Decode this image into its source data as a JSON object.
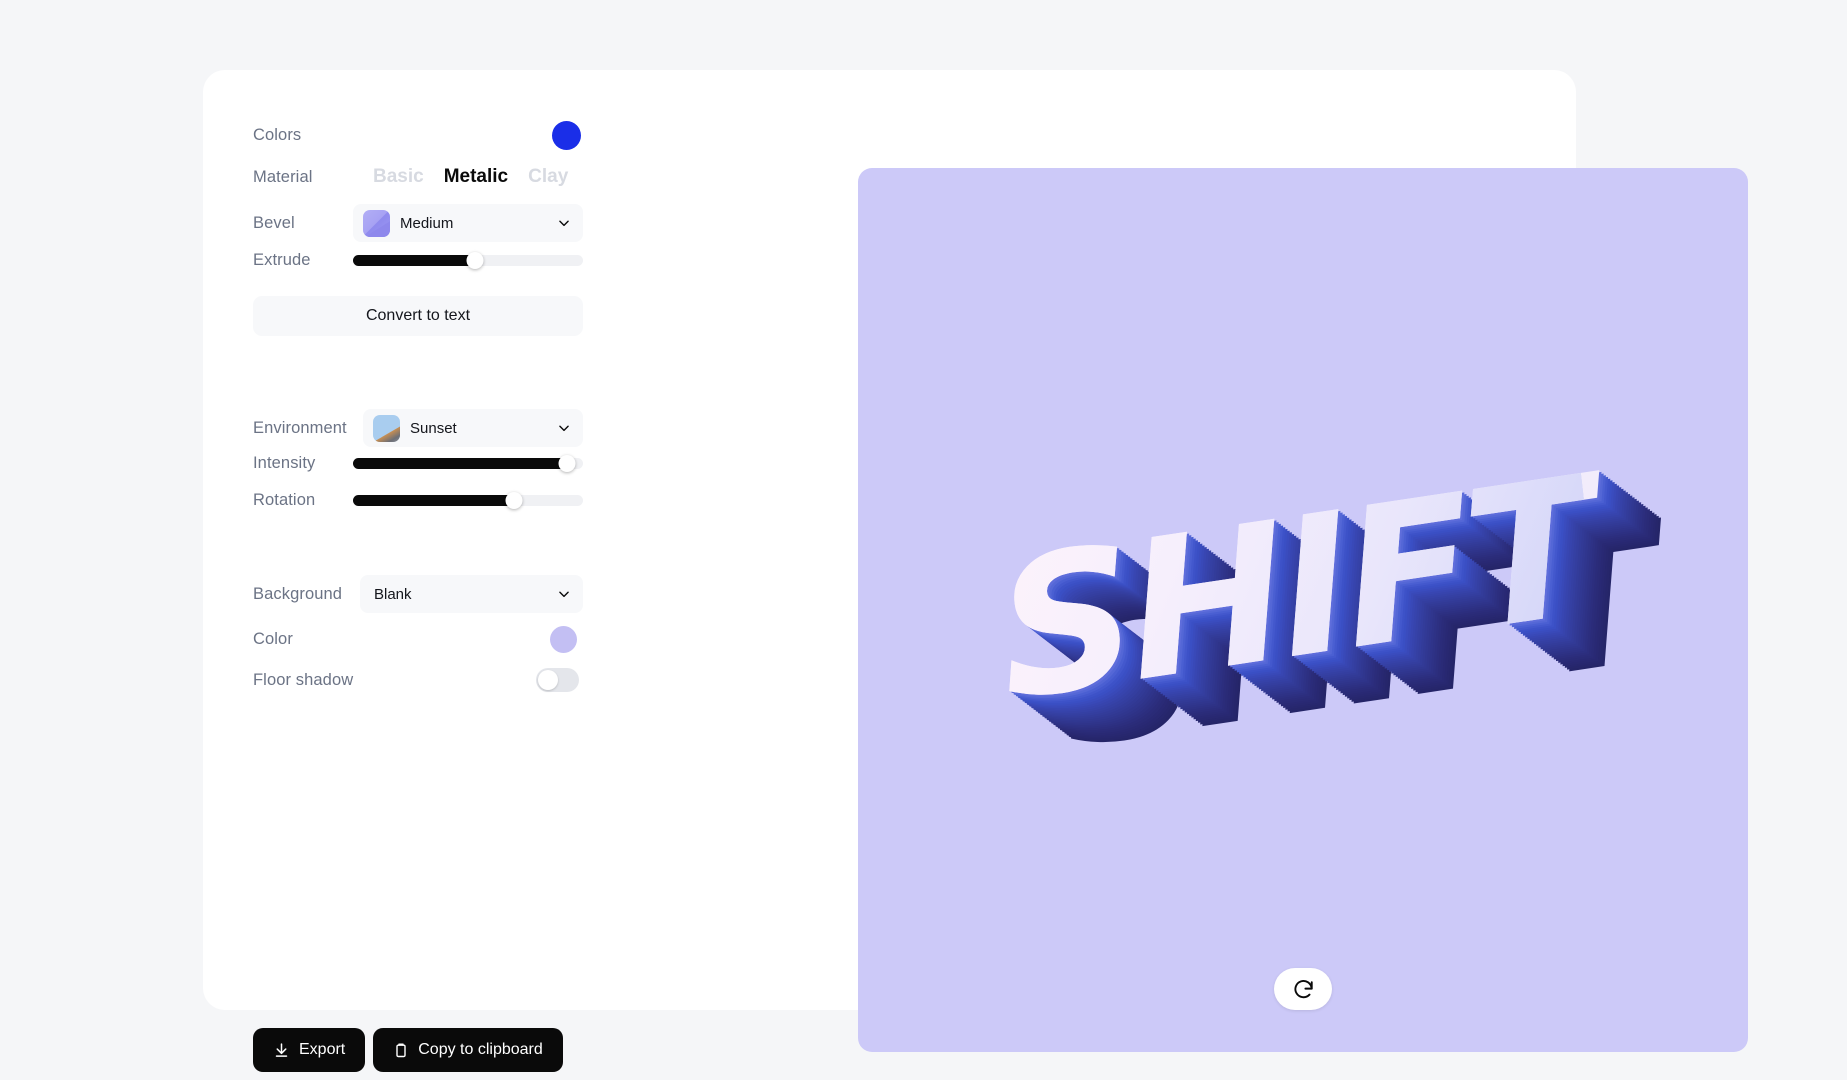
{
  "panel": {
    "colors": {
      "label": "Colors",
      "swatch_color": "#1a2ee8"
    },
    "material": {
      "label": "Material",
      "options": [
        "Basic",
        "Metalic",
        "Clay"
      ],
      "selected": "Metalic"
    },
    "bevel": {
      "label": "Bevel",
      "value": "Medium"
    },
    "extrude": {
      "label": "Extrude",
      "percent": 53
    },
    "convert_button": "Convert to text",
    "environment": {
      "label": "Environment",
      "value": "Sunset"
    },
    "intensity": {
      "label": "Intensity",
      "percent": 93
    },
    "rotation": {
      "label": "Rotation",
      "percent": 70
    },
    "background": {
      "label": "Background",
      "value": "Blank"
    },
    "color": {
      "label": "Color",
      "swatch_color": "#c3bff3"
    },
    "floor_shadow": {
      "label": "Floor shadow",
      "enabled": false
    }
  },
  "actions": {
    "export_label": "Export",
    "copy_label": "Copy to clipboard"
  },
  "canvas": {
    "text": "SHIFT",
    "background_color": "#ccc9f8",
    "face_color": "#f2ecfb",
    "extrude_color": "#3744ad"
  }
}
